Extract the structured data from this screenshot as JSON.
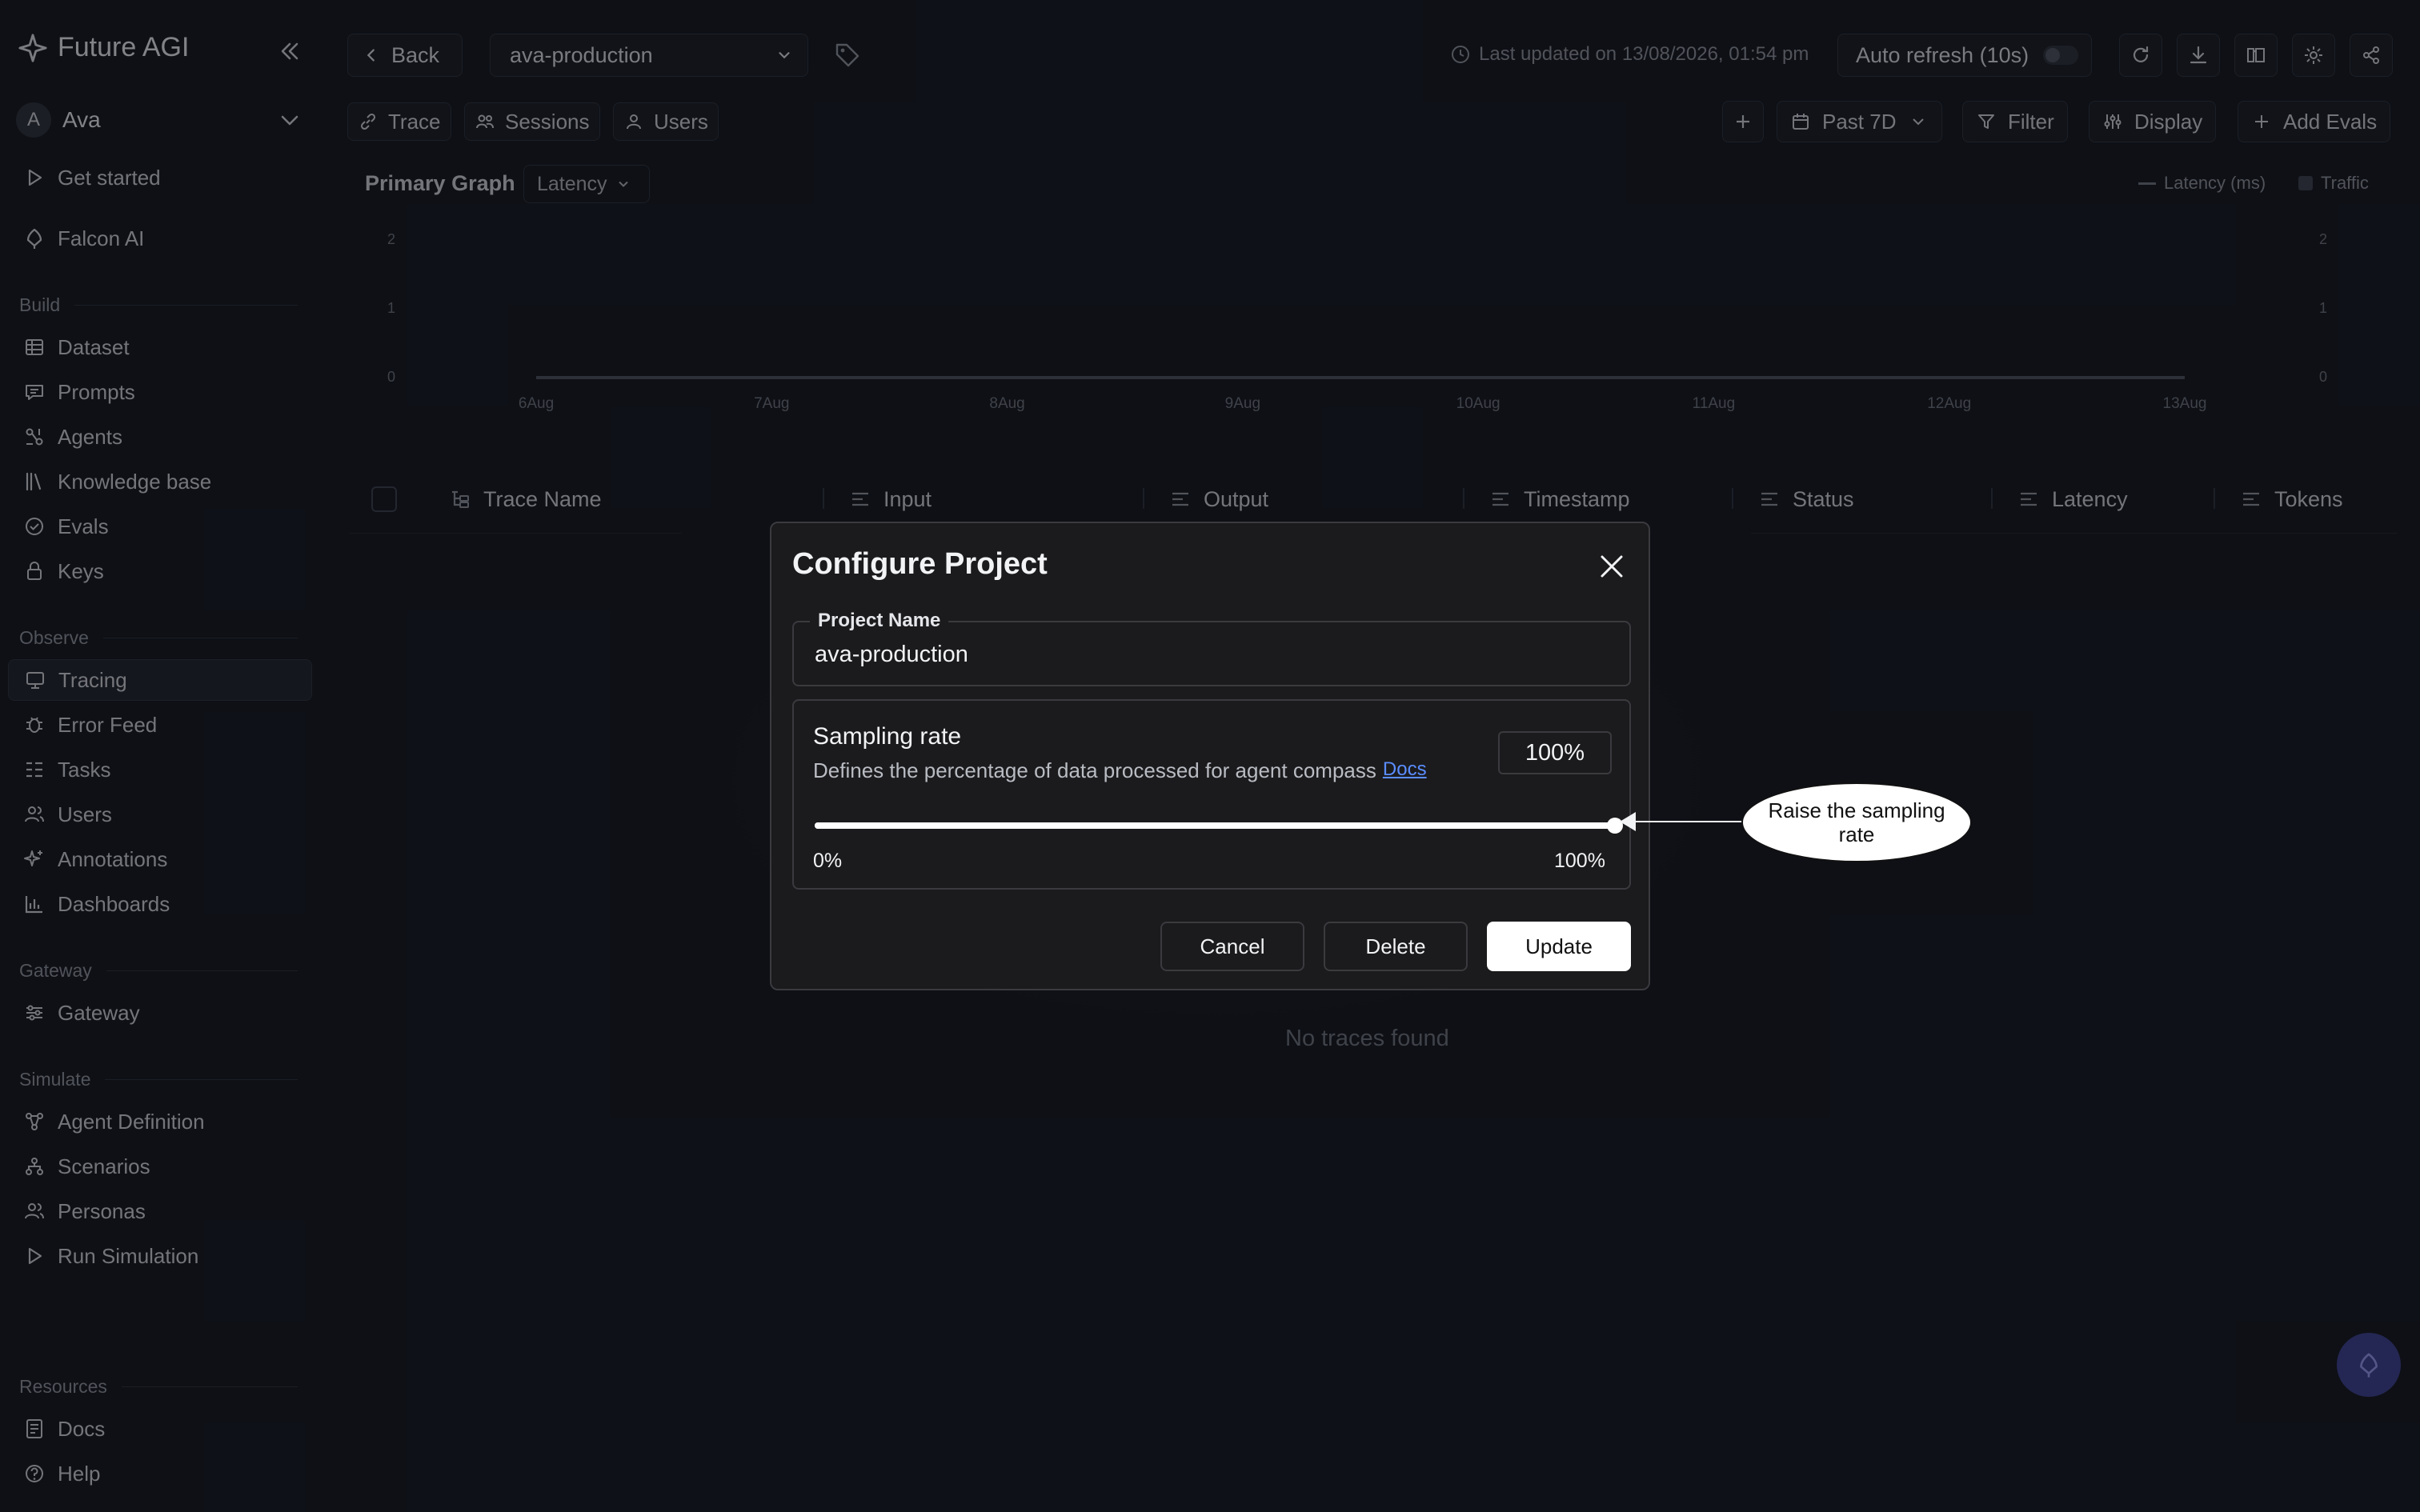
{
  "brand": {
    "name": "Future AGI"
  },
  "workspace": {
    "initial": "A",
    "name": "Ava"
  },
  "nav": {
    "top": [
      {
        "label": "Get started",
        "icon": "play-icon"
      },
      {
        "label": "Falcon AI",
        "icon": "falcon-icon"
      }
    ],
    "build_label": "Build",
    "build": [
      {
        "label": "Dataset",
        "icon": "table-icon"
      },
      {
        "label": "Prompts",
        "icon": "chat-icon"
      },
      {
        "label": "Agents",
        "icon": "agents-icon"
      },
      {
        "label": "Knowledge base",
        "icon": "books-icon"
      },
      {
        "label": "Evals",
        "icon": "check-circle-icon"
      },
      {
        "label": "Keys",
        "icon": "lock-icon"
      }
    ],
    "observe_label": "Observe",
    "observe": [
      {
        "label": "Tracing",
        "icon": "monitor-icon",
        "active": true
      },
      {
        "label": "Error Feed",
        "icon": "bug-icon"
      },
      {
        "label": "Tasks",
        "icon": "tasks-icon"
      },
      {
        "label": "Users",
        "icon": "users-icon"
      },
      {
        "label": "Annotations",
        "icon": "sparkle-icon"
      },
      {
        "label": "Dashboards",
        "icon": "bar-chart-icon"
      }
    ],
    "gateway_label": "Gateway",
    "gateway": [
      {
        "label": "Gateway",
        "icon": "sliders-icon"
      }
    ],
    "simulate_label": "Simulate",
    "simulate": [
      {
        "label": "Agent Definition",
        "icon": "nodes-icon"
      },
      {
        "label": "Scenarios",
        "icon": "tree-icon"
      },
      {
        "label": "Personas",
        "icon": "users-icon"
      },
      {
        "label": "Run Simulation",
        "icon": "play-icon"
      }
    ],
    "resources_label": "Resources",
    "resources": [
      {
        "label": "Docs",
        "icon": "doc-icon"
      },
      {
        "label": "Help",
        "icon": "help-icon"
      }
    ]
  },
  "header": {
    "back_label": "Back",
    "project": "ava-production",
    "last_updated": "Last updated on 13/08/2026, 01:54 pm",
    "auto_refresh": "Auto refresh (10s)"
  },
  "tabs": [
    {
      "label": "Trace",
      "icon": "link-icon"
    },
    {
      "label": "Sessions",
      "icon": "users-icon"
    },
    {
      "label": "Users",
      "icon": "user-icon"
    }
  ],
  "controls": {
    "range": "Past 7D",
    "filter": "Filter",
    "display": "Display",
    "add_evals": "Add Evals"
  },
  "graph": {
    "title": "Primary Graph",
    "metric": "Latency",
    "legend_latency": "Latency (ms)",
    "legend_traffic": "Traffic"
  },
  "chart_data": {
    "type": "line",
    "x": [
      "6Aug",
      "7Aug",
      "8Aug",
      "9Aug",
      "10Aug",
      "11Aug",
      "12Aug",
      "13Aug"
    ],
    "series": [
      {
        "name": "Latency (ms)",
        "values": [
          0,
          0,
          0,
          0,
          0,
          0,
          0,
          0
        ]
      }
    ],
    "yticks": [
      "2",
      "1",
      "0"
    ],
    "ylim": [
      0,
      2
    ]
  },
  "table": {
    "columns": [
      "Trace Name",
      "Input",
      "Output",
      "Timestamp",
      "Status",
      "Latency",
      "Tokens"
    ],
    "empty": "No traces found"
  },
  "dialog": {
    "title": "Configure Project",
    "project_name_label": "Project Name",
    "project_name_value": "ava-production",
    "sampling_title": "Sampling rate",
    "sampling_desc": "Defines the percentage of data processed for agent compass",
    "docs_link": "Docs",
    "sampling_value": "100%",
    "sampling_percent": 100,
    "min_label": "0%",
    "max_label": "100%",
    "cancel": "Cancel",
    "delete": "Delete",
    "update": "Update"
  },
  "annotation": {
    "text": "Raise the sampling rate"
  }
}
